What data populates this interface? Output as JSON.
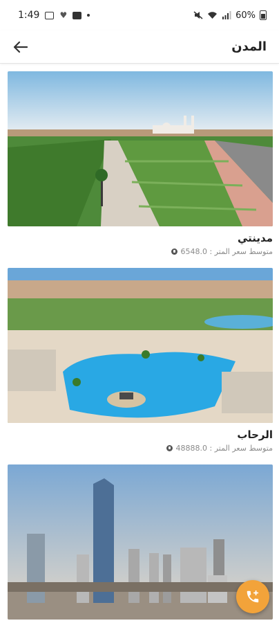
{
  "status_bar": {
    "time": "1:49",
    "battery": "60%"
  },
  "app_bar": {
    "title": "المدن",
    "back_icon": "arrow-left-icon"
  },
  "cities": [
    {
      "name": "مدينتي",
      "price_text": "متوسط سعر المتر : 6548.0"
    },
    {
      "name": "الرحاب",
      "price_text": "متوسط سعر المتر : 48888.0"
    },
    {
      "name": "",
      "price_text": ""
    }
  ],
  "fab": {
    "icon": "phone-add-icon",
    "color": "#f2a33a"
  },
  "colors": {
    "accent": "#f2a33a",
    "title": "#222222",
    "subtitle": "#8a8a8a"
  }
}
